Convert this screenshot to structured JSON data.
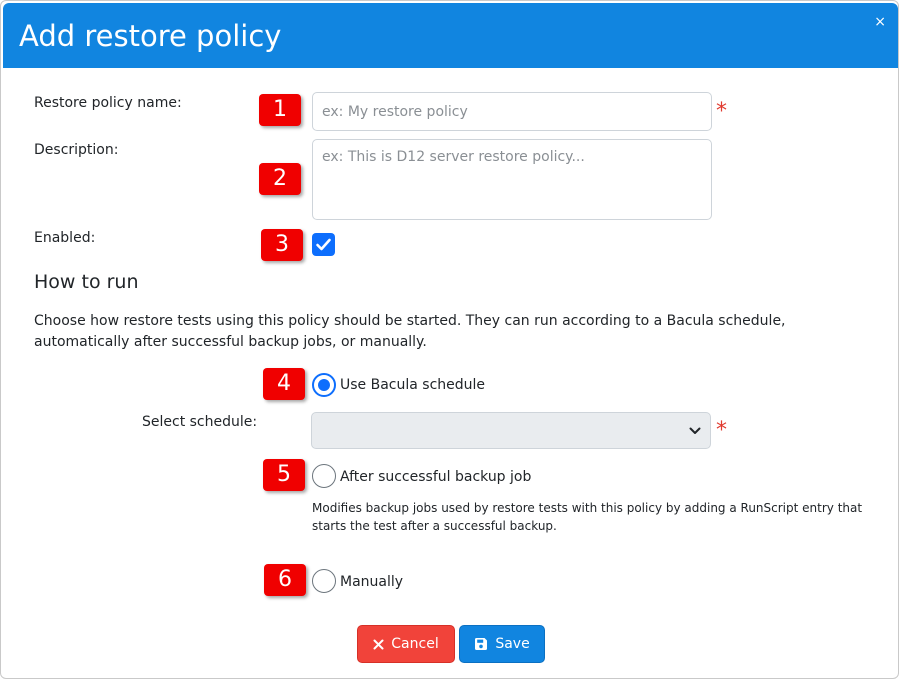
{
  "dialog": {
    "title": "Add restore policy",
    "close_symbol": "×"
  },
  "form": {
    "name": {
      "label": "Restore policy name:",
      "placeholder": "ex: My restore policy",
      "value": "",
      "required_mark": "*"
    },
    "description": {
      "label": "Description:",
      "placeholder": "ex: This is D12 server restore policy...",
      "value": ""
    },
    "enabled": {
      "label": "Enabled:",
      "checked": true
    }
  },
  "how_to_run": {
    "title": "How to run",
    "description": "Choose how restore tests using this policy should be started. They can run according to a Bacula schedule, automatically after successful backup jobs, or manually.",
    "options": [
      {
        "label": "Use Bacula schedule",
        "selected": true
      },
      {
        "label": "After successful backup job",
        "selected": false
      },
      {
        "label": "Manually",
        "selected": false
      }
    ],
    "schedule": {
      "label": "Select schedule:",
      "selected_value": "",
      "required_mark": "*"
    },
    "after_backup_hint": "Modifies backup jobs used by restore tests with this policy by adding a RunScript entry that starts the test after a successful backup."
  },
  "badges": [
    "1",
    "2",
    "3",
    "4",
    "5",
    "6"
  ],
  "buttons": {
    "cancel": {
      "label": "Cancel",
      "icon": "x-icon"
    },
    "save": {
      "label": "Save",
      "icon": "floppy-disk-icon"
    }
  },
  "colors": {
    "titlebar": "#1185e0",
    "badge": "#f00000",
    "accent": "#0d6efd",
    "cancel": "#f1433a",
    "save": "#1185e0",
    "required": "#e03a2f"
  }
}
